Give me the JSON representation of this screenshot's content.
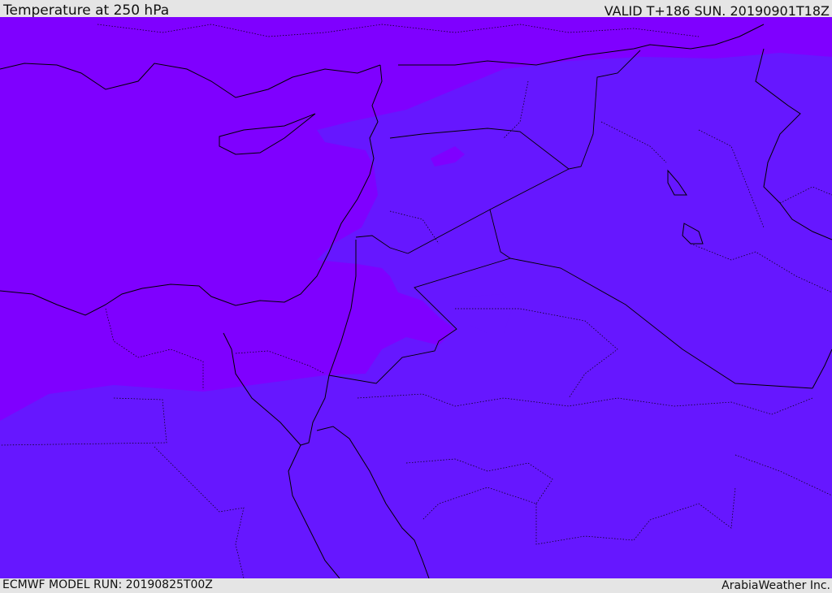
{
  "header": {
    "title": "Temperature at 250 hPa",
    "valid": "VALID T+186 SUN. 20190901T18Z"
  },
  "footer": {
    "model_run": "ECMWF MODEL RUN: 20190825T00Z",
    "credit": "ArabiaWeather Inc."
  },
  "colors": {
    "warm_band": "#7f00ff",
    "cool_band": "#6617ff",
    "background": "#e5e5e5"
  }
}
